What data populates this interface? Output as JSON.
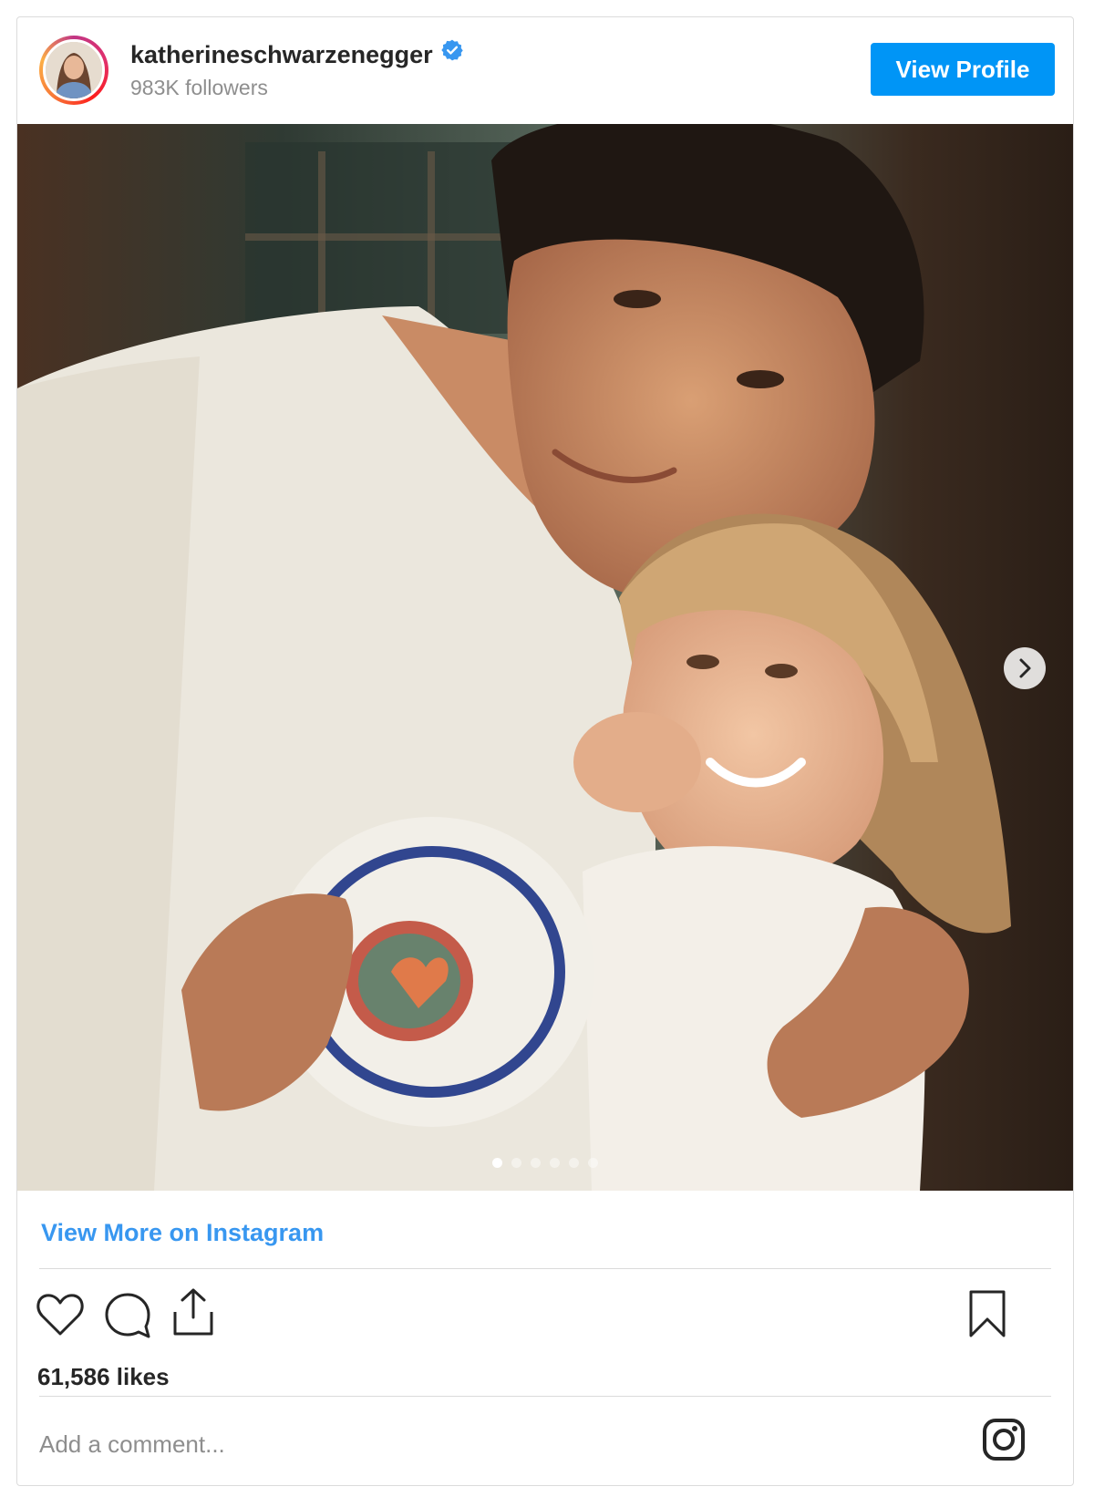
{
  "post": {
    "username": "katherineschwarzenegger",
    "verified_icon": "verified-badge-icon",
    "followers": "983K followers",
    "view_profile_label": "View Profile",
    "view_more_label": "View More on Instagram",
    "likes": "61,586 likes",
    "comment_placeholder": "Add a comment...",
    "carousel": {
      "slide_count": 6,
      "active_index": 0
    },
    "actions": [
      "heart-icon",
      "comment-icon",
      "share-icon"
    ],
    "save_icon": "bookmark-icon",
    "brand_icon": "instagram-icon"
  },
  "colors": {
    "accent": "#0095f6",
    "link": "#3897f0",
    "text": "#262626",
    "muted": "#8e8e8e",
    "border": "#dbdbdb"
  }
}
